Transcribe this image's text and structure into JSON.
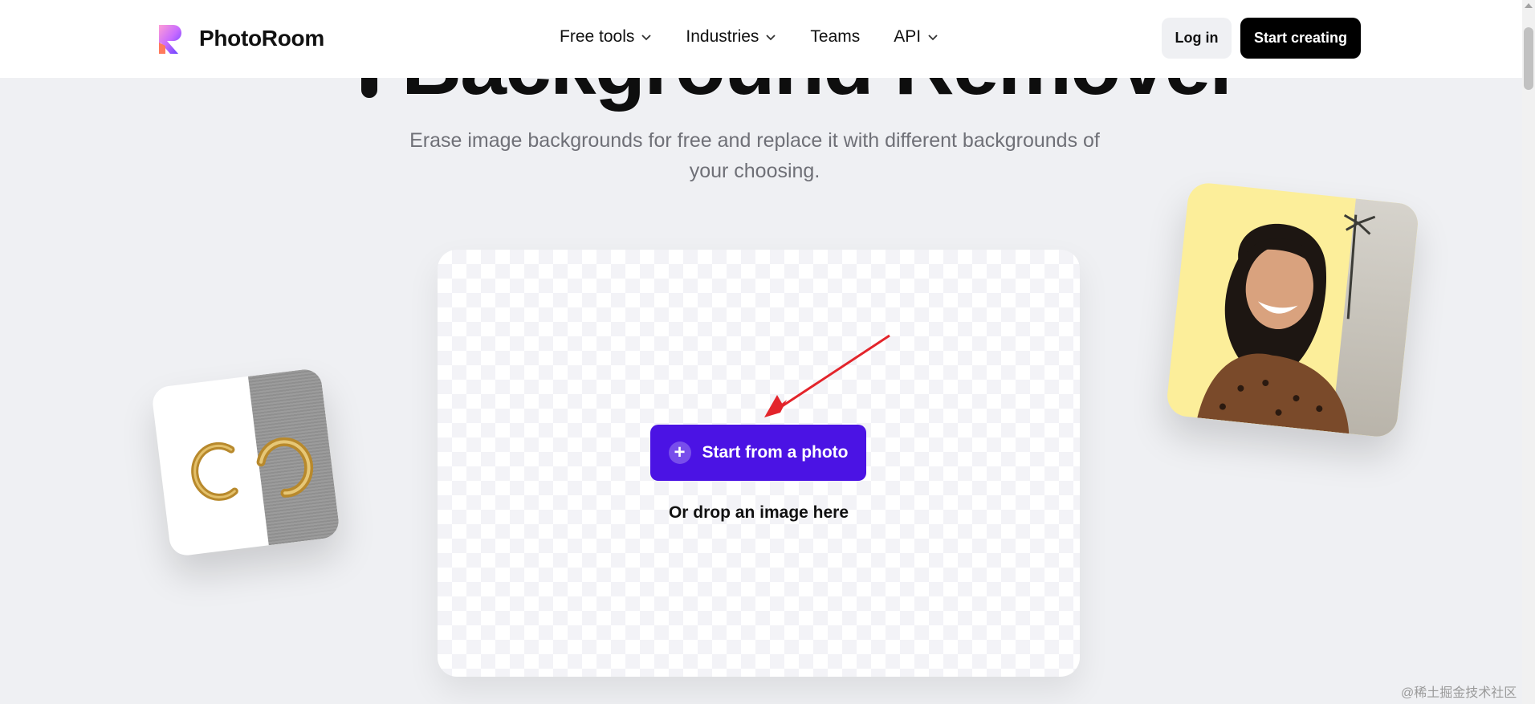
{
  "hero": {
    "title": "Background Remover",
    "subtitle_line1": "Erase image backgrounds for free and replace it with different backgrounds of",
    "subtitle_line2": "your choosing."
  },
  "header": {
    "brand": "PhotoRoom",
    "nav": [
      {
        "label": "Free tools",
        "has_dropdown": true
      },
      {
        "label": "Industries",
        "has_dropdown": true
      },
      {
        "label": "Teams",
        "has_dropdown": false
      },
      {
        "label": "API",
        "has_dropdown": true
      }
    ],
    "login_label": "Log in",
    "start_label": "Start creating"
  },
  "upload": {
    "button_label": "Start from a photo",
    "drop_text": "Or drop an image here"
  },
  "watermark": "@稀土掘金技术社区",
  "colors": {
    "accent": "#4b13e4",
    "background": "#eff0f3",
    "annotation_arrow": "#e3242b"
  },
  "icons": {
    "logo": "photoroom-logo-icon",
    "chevron": "chevron-down-icon",
    "plus": "plus-icon",
    "hero": "transparent-image-icon"
  }
}
